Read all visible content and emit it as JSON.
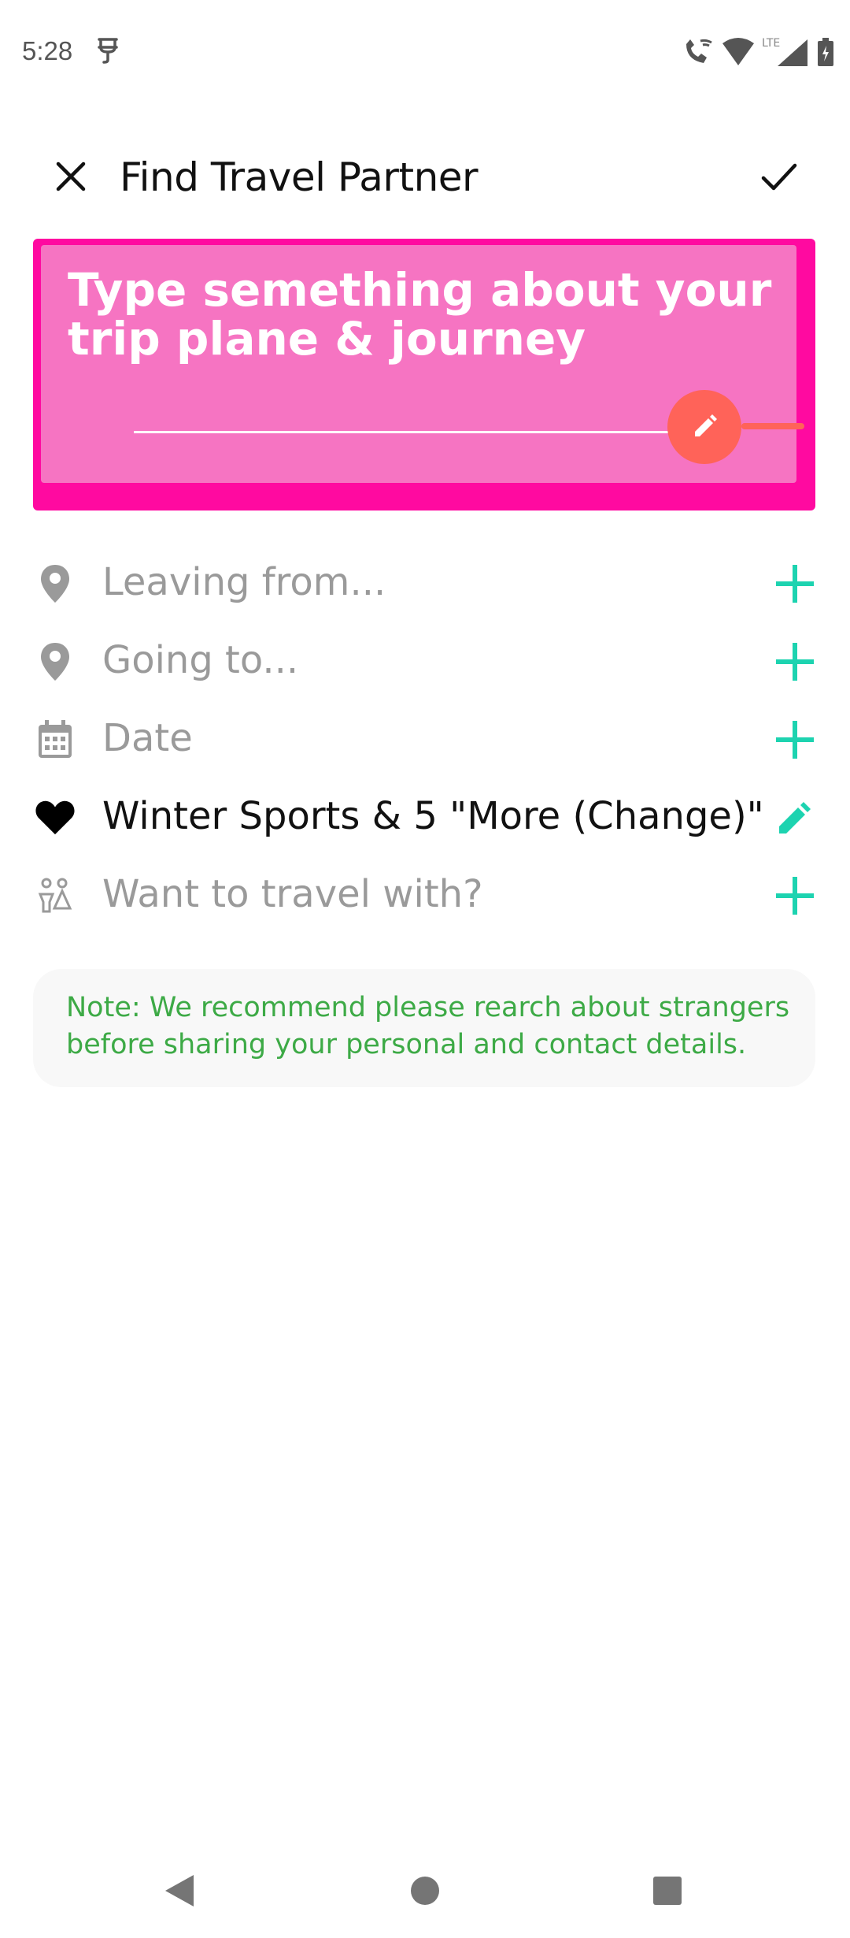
{
  "status_bar": {
    "time": "5:28",
    "network": "LTE",
    "icons": [
      "app-notification-icon",
      "wifi-calling-icon",
      "wifi-icon",
      "signal-icon",
      "battery-charging-icon"
    ]
  },
  "app_bar": {
    "title": "Find Travel Partner",
    "close_icon": "close-icon",
    "confirm_icon": "check-icon"
  },
  "trip_card": {
    "text": "Type semething about your trip plane & journey",
    "edit_icon": "pencil-icon",
    "colors": {
      "outer": "#ff0aa0",
      "inner": "#f674c2",
      "fab": "#ff6359"
    }
  },
  "form": {
    "leaving_from": {
      "label": "Leaving from...",
      "icon": "location-pin-icon",
      "action_icon": "plus-icon"
    },
    "going_to": {
      "label": "Going to...",
      "icon": "location-pin-icon",
      "action_icon": "plus-icon"
    },
    "date": {
      "label": "Date",
      "icon": "calendar-icon",
      "action_icon": "plus-icon"
    },
    "interests": {
      "label": "Winter Sports & 5 \"More (Change)\"",
      "icon": "heart-icon",
      "action_icon": "pencil-icon"
    },
    "travel_with": {
      "label": "Want to travel with?",
      "icon": "people-icon",
      "action_icon": "plus-icon"
    }
  },
  "note": {
    "text": "Note: We recommend please rearch about strangers before sharing your personal and contact details."
  },
  "colors": {
    "accent": "#1dd3b0",
    "placeholder": "#9a9a9a",
    "note_text": "#3daa46"
  },
  "nav_bar": {
    "icons": [
      "back-icon",
      "home-icon",
      "recents-icon"
    ]
  }
}
